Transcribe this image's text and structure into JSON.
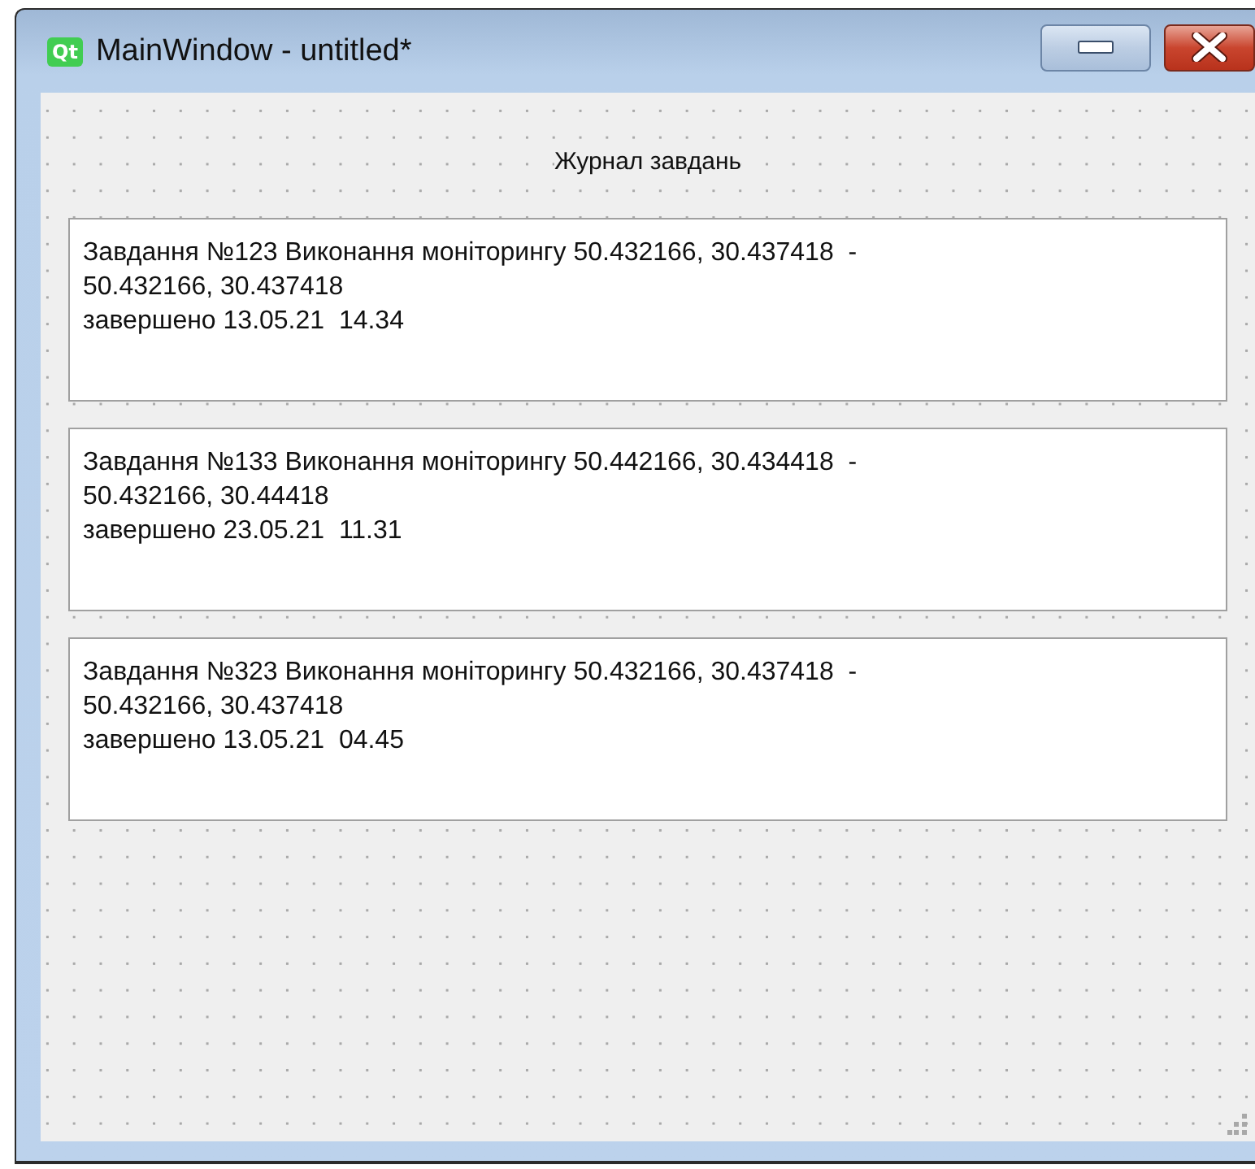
{
  "window": {
    "logo": "Qt",
    "title": "MainWindow - untitled*"
  },
  "heading": "Журнал завдань",
  "tasks": [
    {
      "lines": [
        "Завдання №123 Виконання моніторингу 50.432166, 30.437418  -",
        "50.432166, 30.437418",
        "завершено 13.05.21  14.34"
      ]
    },
    {
      "lines": [
        "Завдання №133 Виконання моніторингу 50.442166, 30.434418  -",
        "50.432166, 30.44418",
        "завершено 23.05.21  11.31"
      ]
    },
    {
      "lines": [
        "Завдання №323 Виконання моніторингу 50.432166, 30.437418  -",
        "50.432166, 30.437418",
        "завершено 13.05.21  04.45"
      ]
    }
  ]
}
